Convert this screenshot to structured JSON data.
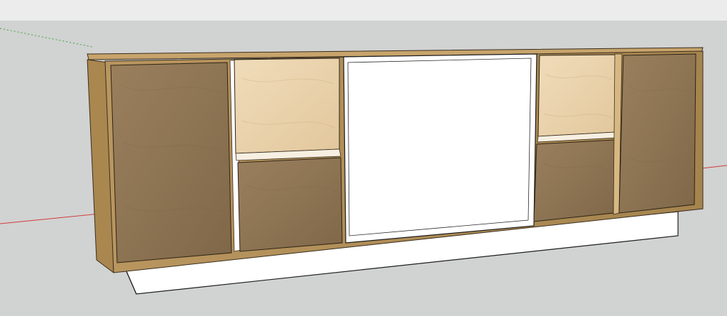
{
  "app": {
    "toolbar": "",
    "viewport": "3d-model-view"
  },
  "colors": {
    "background": "#d1d2d2",
    "top_bar": "#ececec",
    "wood_frame": "#a9874f",
    "wood_edge": "#d5b47c",
    "walnut_panel": "#8e7554",
    "light_panel": "#e8d2ac",
    "white_panel": "#ffffff",
    "base_plinth": "#ffffff",
    "axis_red": "#d23c3c",
    "axis_green": "#3aa43a"
  },
  "model": {
    "object": "sideboard-cabinet",
    "panels": [
      {
        "id": "left-door",
        "finish": "walnut"
      },
      {
        "id": "center-left-top-drawer",
        "finish": "light"
      },
      {
        "id": "center-left-bottom-drawer",
        "finish": "walnut"
      },
      {
        "id": "center-panel",
        "finish": "white"
      },
      {
        "id": "center-right-top-drawer",
        "finish": "light"
      },
      {
        "id": "center-right-bottom-drawer",
        "finish": "walnut"
      },
      {
        "id": "right-door",
        "finish": "walnut"
      }
    ]
  }
}
